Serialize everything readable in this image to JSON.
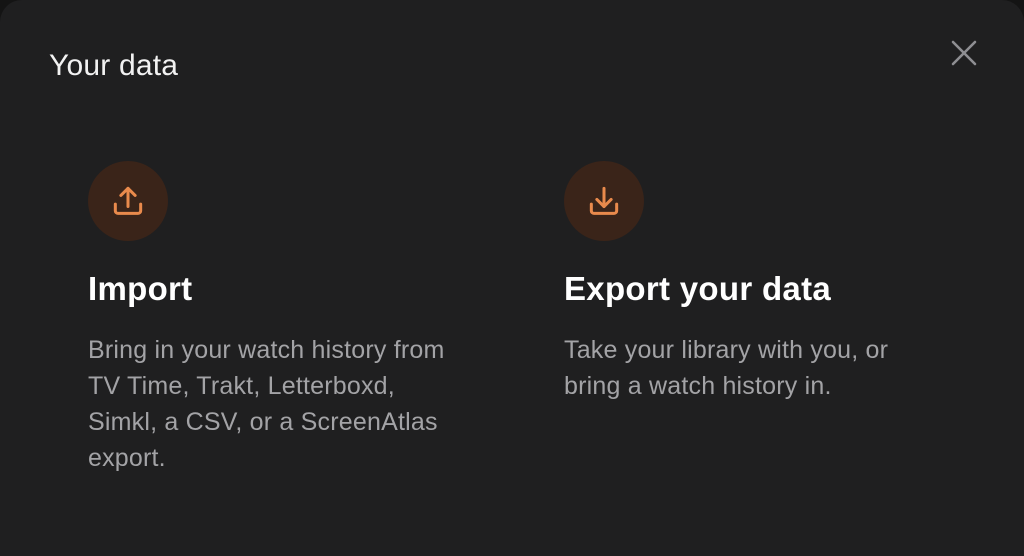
{
  "modal": {
    "title": "Your data",
    "close_icon": "close-icon"
  },
  "cards": [
    {
      "icon": "upload-icon",
      "title": "Import",
      "description": "Bring in your watch history from TV Time, Trakt, Letterboxd, Simkl, a CSV, or a ScreenAtlas export."
    },
    {
      "icon": "download-icon",
      "title": "Export your data",
      "description": "Take your library with you, or bring a watch history in."
    }
  ],
  "colors": {
    "background": "#1f1f20",
    "accent": "#e98a4c",
    "icon_circle": "#3a2419",
    "title_text": "#ffffff",
    "body_text": "#a3a3a6",
    "close_icon": "#8e8e92"
  }
}
